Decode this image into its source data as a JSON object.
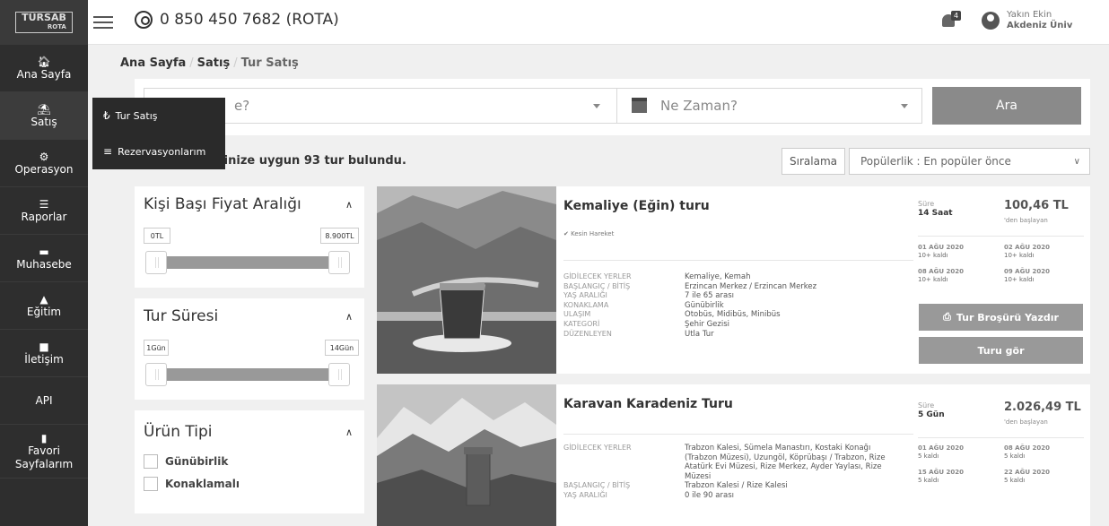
{
  "header": {
    "logo_text": "TÜRSAB",
    "logo_sub": "ROTA",
    "phone": "0 850 450 7682 (ROTA)",
    "notification_count": "4",
    "user_name": "Yakın Ekin",
    "user_org": "Akdeniz Üniv"
  },
  "sidebar": {
    "items": [
      {
        "label": "Ana Sayfa",
        "icon": "home-icon"
      },
      {
        "label": "Satış",
        "icon": "shop-icon"
      },
      {
        "label": "Operasyon",
        "icon": "gears-icon"
      },
      {
        "label": "Raporlar",
        "icon": "list-icon"
      },
      {
        "label": "Muhasebe",
        "icon": "money-icon"
      },
      {
        "label": "Eğitim",
        "icon": "graduation-icon"
      },
      {
        "label": "İletişim",
        "icon": "contact-icon"
      },
      {
        "label": "API",
        "icon": ""
      },
      {
        "label": "Favori Sayfalarım",
        "icon": "bookmark-icon"
      }
    ]
  },
  "flyout": {
    "items": [
      {
        "label": "Tur Satış",
        "icon": "lira-icon"
      },
      {
        "label": "Rezervasyonlarım",
        "icon": "list-icon"
      }
    ]
  },
  "breadcrumb": [
    "Ana Sayfa",
    "Satış",
    "Tur Satış"
  ],
  "search": {
    "where_placeholder": "e?",
    "when_placeholder": "Ne Zaman?",
    "button": "Ara"
  },
  "results": {
    "text": "lerinize uygun 93 tur bulundu.",
    "sort_label": "Sıralama",
    "sort_value": "Popülerlik : En popüler önce"
  },
  "filters": {
    "price": {
      "title": "Kişi Başı Fiyat Aralığı",
      "min_label": "0TL",
      "max_label": "8.900TL",
      "min_value": 0,
      "max_value": 8900
    },
    "duration": {
      "title": "Tur Süresi",
      "min_label": "1Gün",
      "max_label": "14Gün",
      "min_value": 1,
      "max_value": 14
    },
    "product_type": {
      "title": "Ürün Tipi",
      "options": [
        "Günübirlik",
        "Konaklamalı"
      ]
    }
  },
  "tours": [
    {
      "title": "Kemaliye (Eğin) turu",
      "tag": "Kesin Hareket",
      "info_labels": [
        "GİDİLECEK YERLER",
        "BAŞLANGIÇ / BİTİŞ",
        "YAŞ ARALIĞI",
        "KONAKLAMA",
        "ULAŞIM",
        "KATEGORİ",
        "DÜZENLEYEN"
      ],
      "info_values": [
        "Kemaliye, Kemah",
        "Erzincan Merkez / Erzincan Merkez",
        "7 ile 65 arası",
        "Günübirlik",
        "Otobüs, Midibüs, Minibüs",
        "Şehir Gezisi",
        "Utla Tur"
      ],
      "duration_label": "Süre",
      "duration": "14 Saat",
      "price": "100,46 TL",
      "price_sub": "'den başlayan",
      "dates": [
        {
          "date": "01 AĞU 2020",
          "status": "10+ kaldı"
        },
        {
          "date": "02 AĞU 2020",
          "status": "10+ kaldı"
        },
        {
          "date": "08 AĞU 2020",
          "status": "10+ kaldı"
        },
        {
          "date": "09 AĞU 2020",
          "status": "10+ kaldı"
        }
      ],
      "brochure_button": "Tur Broşürü Yazdır",
      "view_button": "Turu gör"
    },
    {
      "title": "Karavan Karadeniz Turu",
      "info_labels": [
        "GİDİLECEK YERLER",
        "",
        "",
        "",
        "BAŞLANGIÇ / BİTİŞ",
        "YAŞ ARALIĞI"
      ],
      "destinations": "Trabzon Kalesi, Sümela Manastırı, Kostaki Konağı (Trabzon Müzesi), Uzungöl, Köprübaşı / Trabzon, Rize Atatürk Evi Müzesi, Rize Merkez, Ayder Yaylası, Rize Müzesi",
      "start_end": "Trabzon Kalesi / Rize Kalesi",
      "age_range": "0 ile 90 arası",
      "duration_label": "Süre",
      "duration": "5 Gün",
      "price": "2.026,49 TL",
      "price_sub": "'den başlayan",
      "dates": [
        {
          "date": "01 AĞU 2020",
          "status": "5 kaldı"
        },
        {
          "date": "08 AĞU 2020",
          "status": "5 kaldı"
        },
        {
          "date": "15 AĞU 2020",
          "status": "5 kaldı"
        },
        {
          "date": "22 AĞU 2020",
          "status": "5 kaldı"
        }
      ]
    }
  ]
}
